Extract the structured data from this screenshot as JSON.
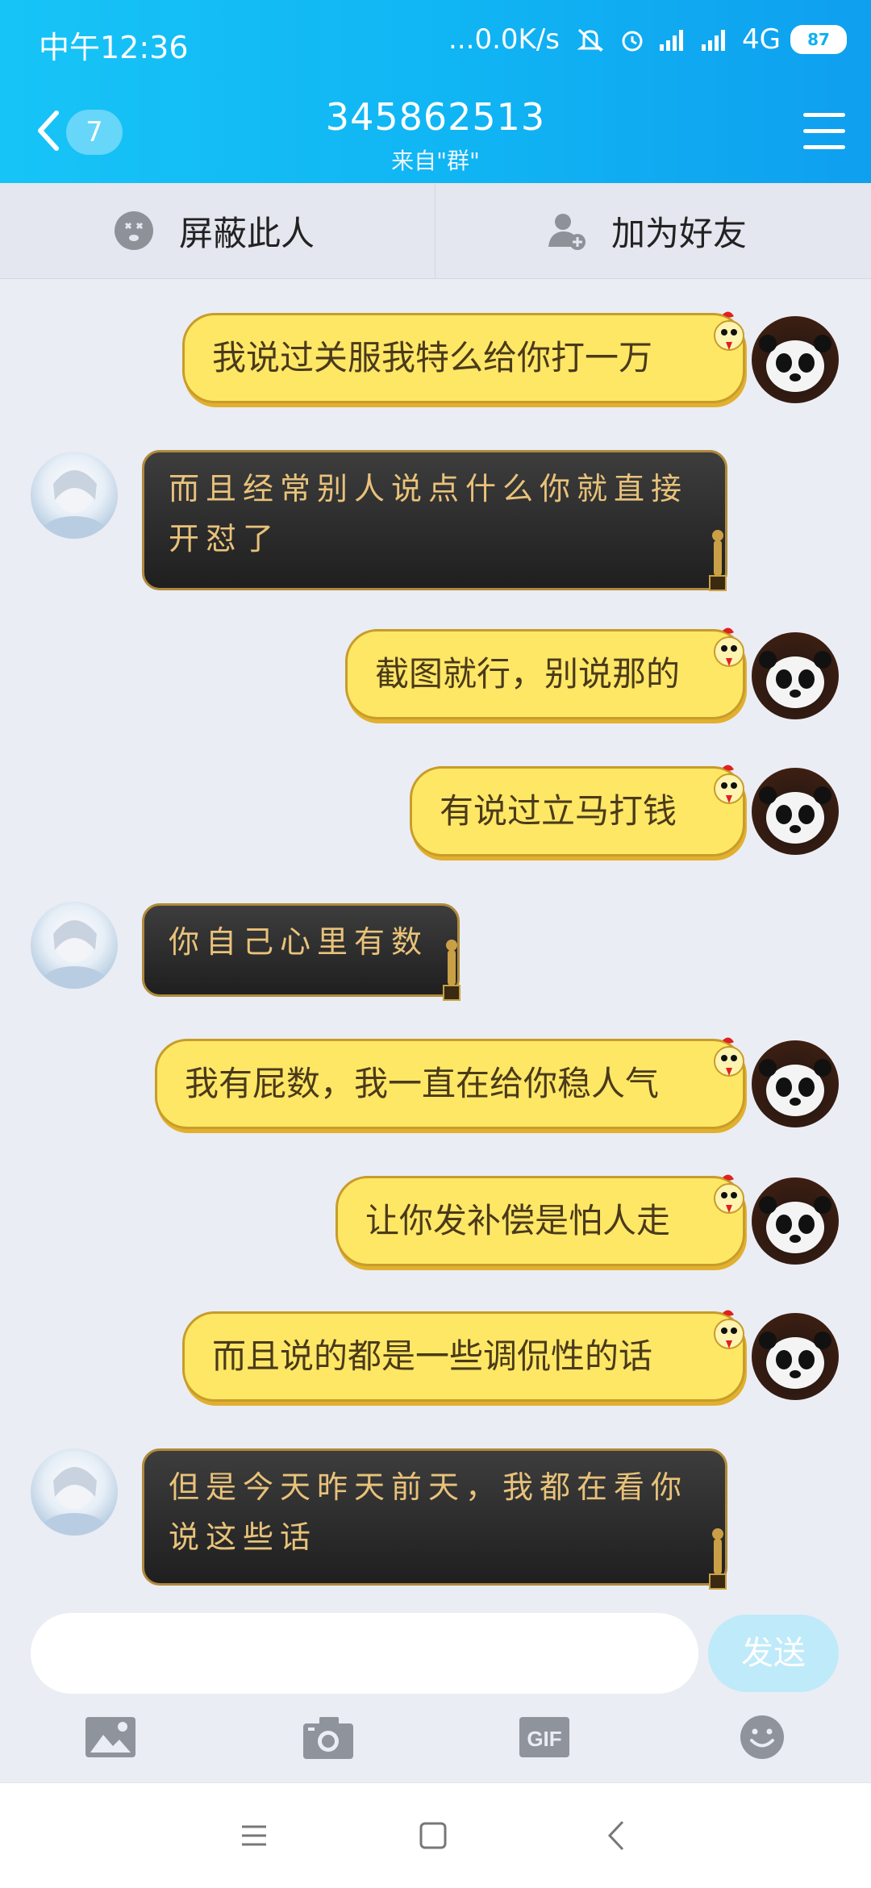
{
  "status_bar": {
    "time": "中午12:36",
    "net_speed": "...0.0K/s",
    "network": "4G",
    "battery": "87"
  },
  "header": {
    "unread_count": "7",
    "title": "345862513",
    "subtitle": "来自\"群\""
  },
  "actions": {
    "block_label": "屏蔽此人",
    "add_friend_label": "加为好友"
  },
  "messages": [
    {
      "side": "sent",
      "text": "我说过关服我特么给你打一万"
    },
    {
      "side": "received",
      "text_line1": "而且经常别人说点什么你就直接",
      "text_line2": "开怼了"
    },
    {
      "side": "sent",
      "text": "截图就行，别说那的"
    },
    {
      "side": "sent",
      "text": "有说过立马打钱"
    },
    {
      "side": "received",
      "text": "你自己心里有数"
    },
    {
      "side": "sent",
      "text": "我有屁数，我一直在给你稳人气"
    },
    {
      "side": "sent",
      "text": "让你发补偿是怕人走"
    },
    {
      "side": "sent",
      "text": "而且说的都是一些调侃性的话"
    },
    {
      "side": "received",
      "text_line1": "但是今天昨天前天，我都在看你",
      "text_line2": "说这些话"
    }
  ],
  "composer": {
    "placeholder": "",
    "send_label": "发送"
  },
  "colors": {
    "header": "#10b4f3",
    "sent_bubble": "#ffe766",
    "received_bubble": "#2a2a2a"
  },
  "icons": {
    "toolbar": [
      "image-icon",
      "camera-icon",
      "gif-icon",
      "emoji-icon"
    ],
    "nav": [
      "menu-nav-icon",
      "home-nav-icon",
      "back-nav-icon"
    ]
  }
}
